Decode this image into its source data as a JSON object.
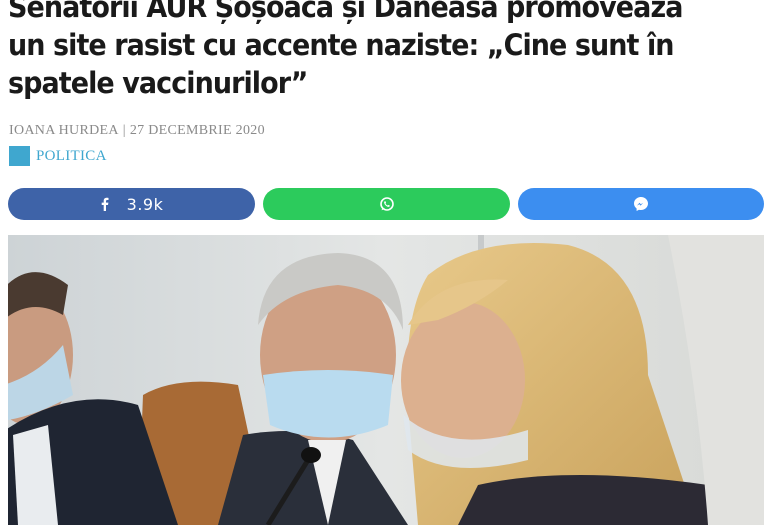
{
  "article": {
    "title": "Senatorii AUR Șoșoacă și Dăneasă promovează un site rasist cu accente naziste: „Cine sunt în spatele vaccinurilor”",
    "author": "IOANA HURDEA",
    "separator": "|",
    "date": "27 DECEMBRIE 2020",
    "category": "POLITICA"
  },
  "share": {
    "facebook": {
      "icon": "facebook-icon",
      "count": "3.9k"
    },
    "whatsapp": {
      "icon": "whatsapp-icon"
    },
    "messenger": {
      "icon": "messenger-icon"
    }
  },
  "colors": {
    "headline": "#1a1a1a",
    "meta": "#8a8a8a",
    "category": "#3fa7cf",
    "facebook": "#3e63a8",
    "whatsapp": "#2ccb5c",
    "messenger": "#3c8ef0"
  }
}
